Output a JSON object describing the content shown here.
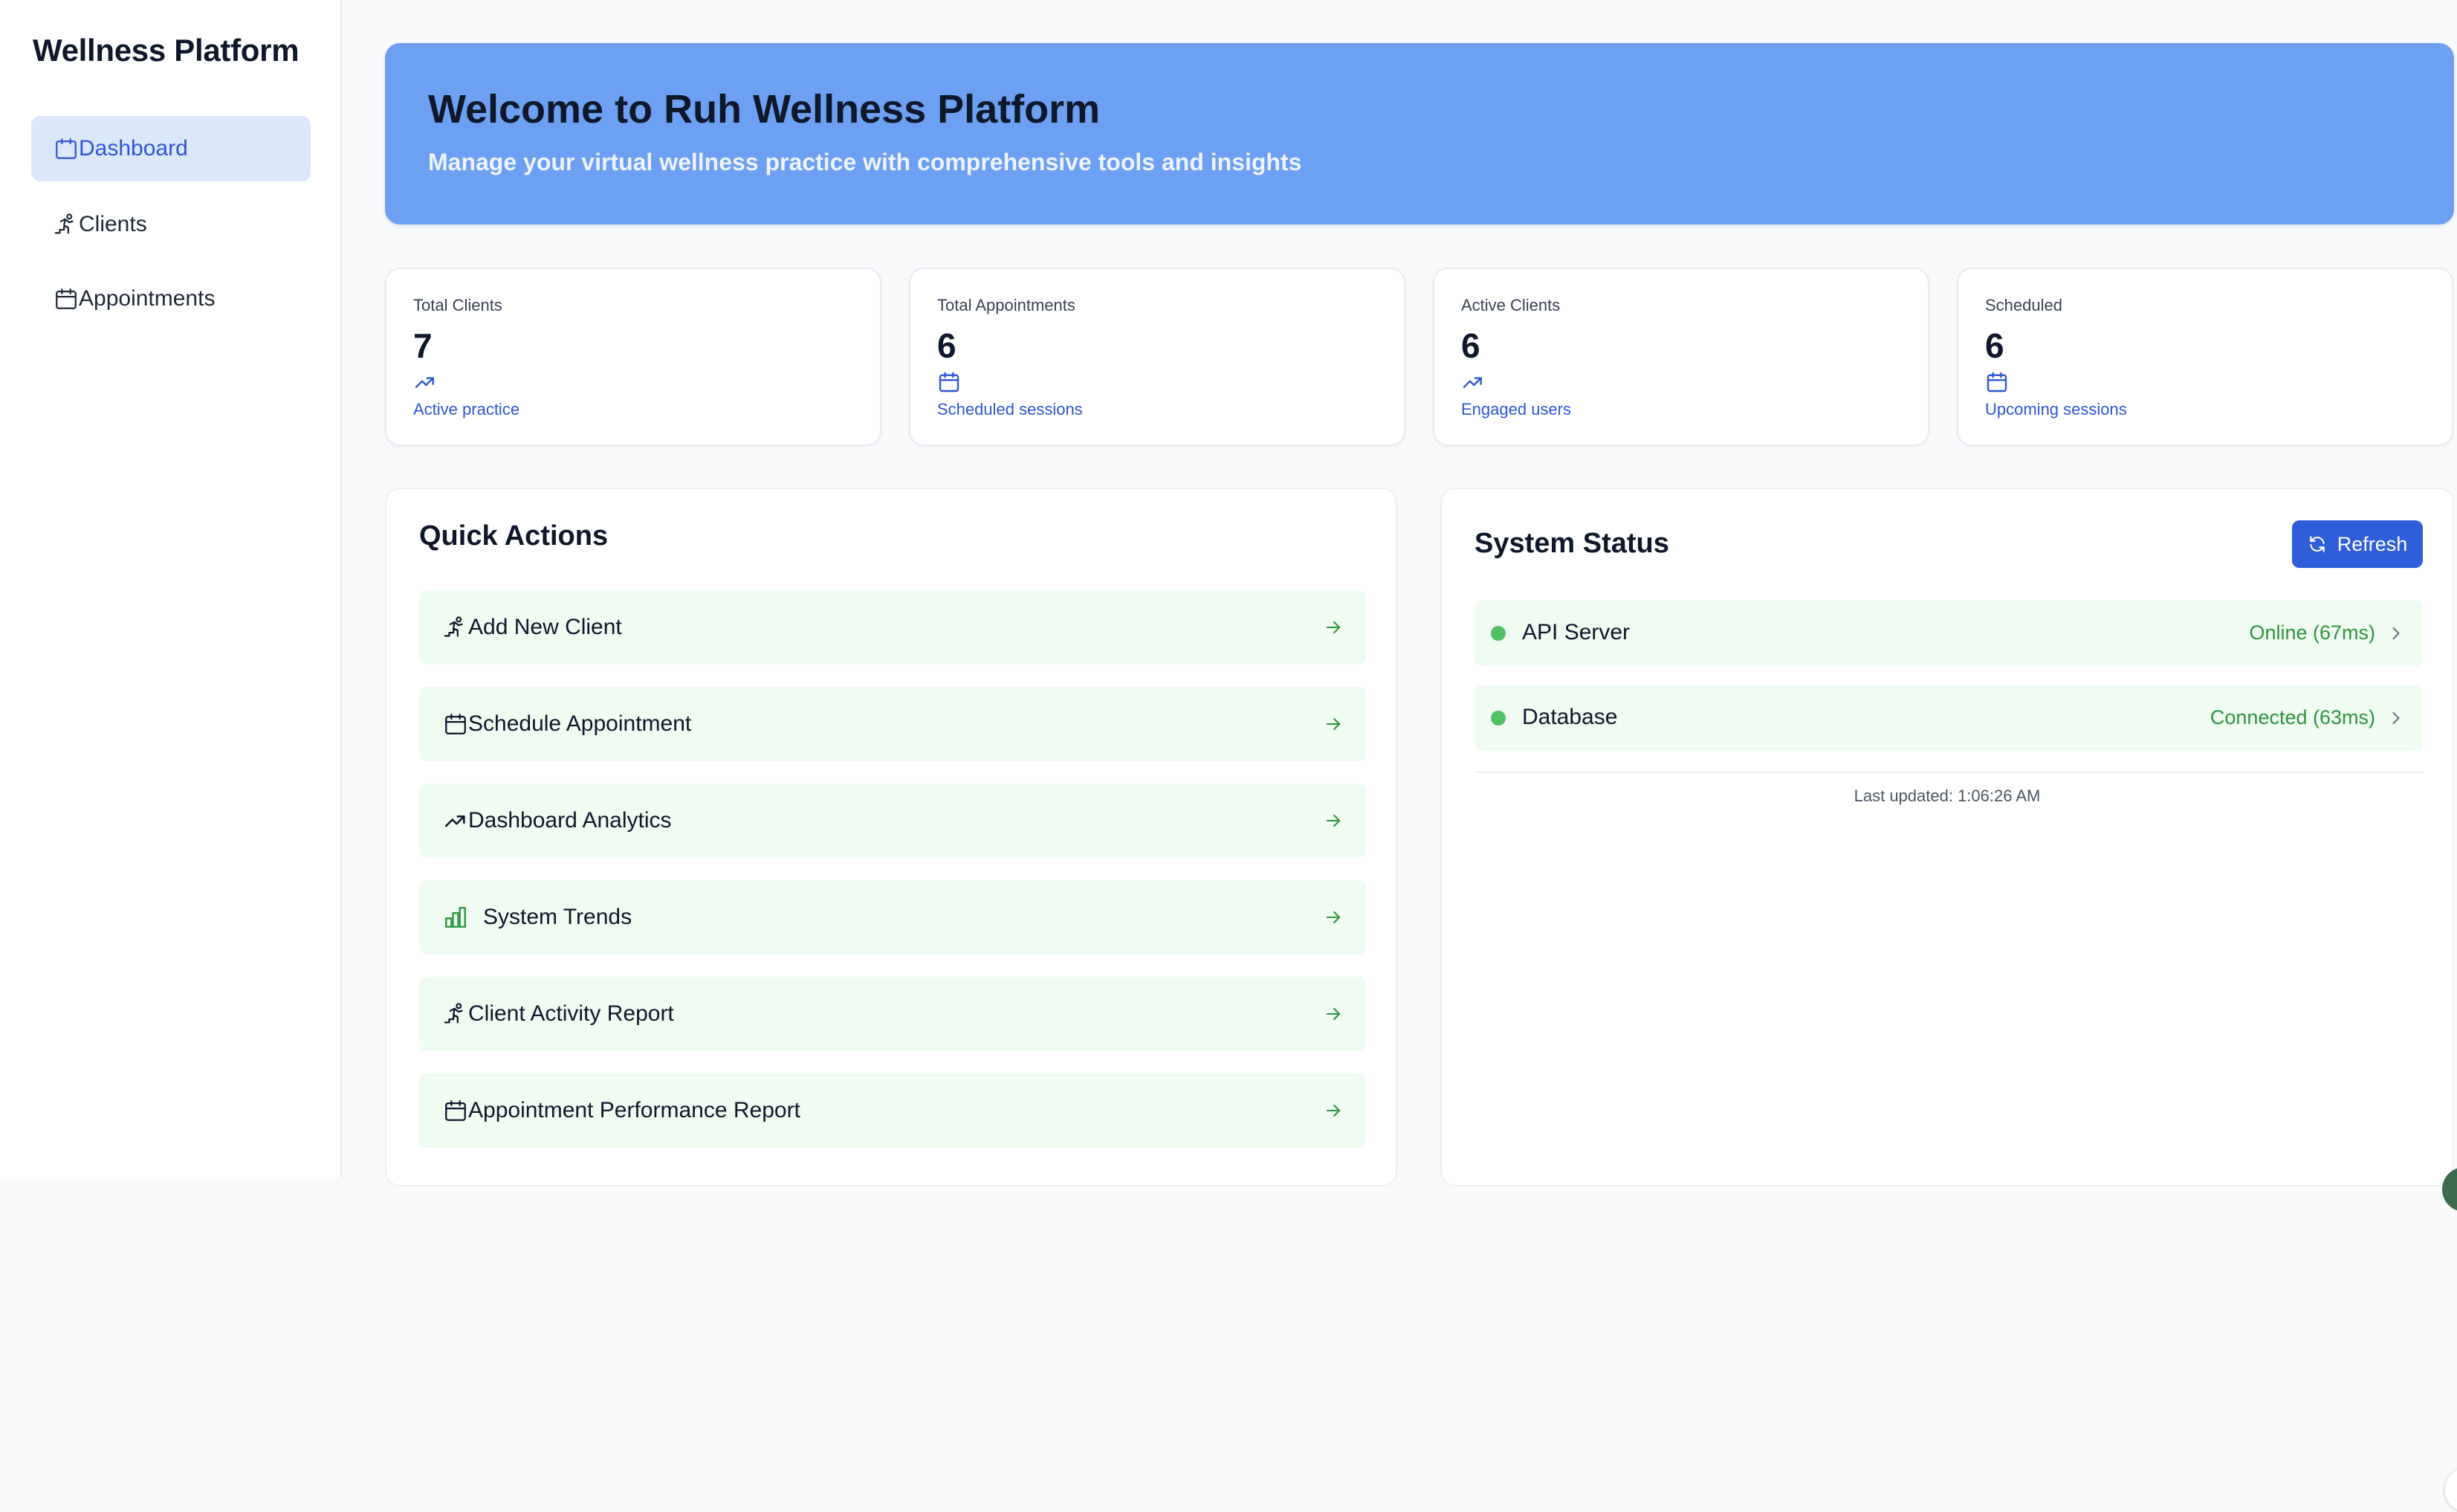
{
  "sidebar": {
    "title": "Wellness Platform",
    "items": [
      {
        "label": "Dashboard",
        "icon": "calendar-icon",
        "active": true
      },
      {
        "label": "Clients",
        "icon": "user-stairs-icon",
        "active": false
      },
      {
        "label": "Appointments",
        "icon": "calendar-icon",
        "active": false
      }
    ]
  },
  "hero": {
    "title": "Welcome to Ruh Wellness Platform",
    "subtitle": "Manage your virtual wellness practice with comprehensive tools and insights"
  },
  "stats": [
    {
      "label": "Total Clients",
      "value": "7",
      "icon": "trending-up-icon",
      "footnote": "Active practice"
    },
    {
      "label": "Total Appointments",
      "value": "6",
      "icon": "calendar-icon",
      "footnote": "Scheduled sessions"
    },
    {
      "label": "Active Clients",
      "value": "6",
      "icon": "trending-up-icon",
      "footnote": "Engaged users"
    },
    {
      "label": "Scheduled",
      "value": "6",
      "icon": "calendar-icon",
      "footnote": "Upcoming sessions"
    }
  ],
  "quick_actions": {
    "title": "Quick Actions",
    "items": [
      {
        "label": "Add New Client",
        "icon": "user-stairs-icon"
      },
      {
        "label": "Schedule Appointment",
        "icon": "calendar-icon"
      },
      {
        "label": "Dashboard Analytics",
        "icon": "trending-up-icon"
      },
      {
        "label": "System Trends",
        "icon": "bar-chart-icon"
      },
      {
        "label": "Client Activity Report",
        "icon": "user-stairs-icon"
      },
      {
        "label": "Appointment Performance Report",
        "icon": "calendar-icon"
      }
    ]
  },
  "system_status": {
    "title": "System Status",
    "refresh_label": "Refresh",
    "services": [
      {
        "name": "API Server",
        "status": "Online (67ms)"
      },
      {
        "name": "Database",
        "status": "Connected (63ms)"
      }
    ],
    "last_updated": "Last updated: 1:06:26 AM"
  },
  "colors": {
    "accent": "#2f5ed8",
    "hero_bg": "#6da0f2",
    "nav_active_bg": "#dbe7fb",
    "action_bg": "#f0fbf2",
    "status_ok": "#4fc162",
    "status_text": "#2f9440"
  }
}
